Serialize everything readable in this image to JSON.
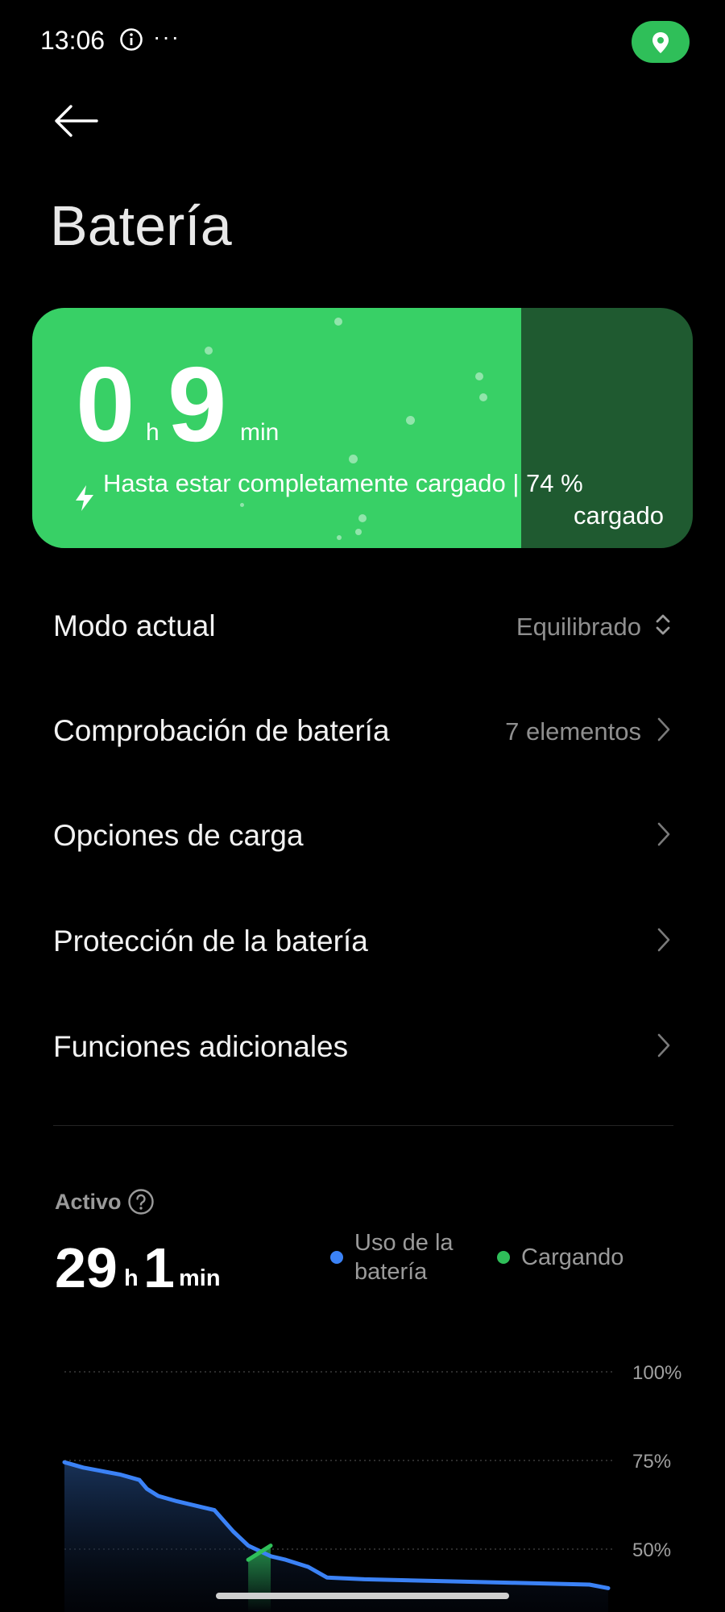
{
  "status_bar": {
    "time": "13:06",
    "dots": "···",
    "icons": [
      "info-icon",
      "location-icon"
    ]
  },
  "header": {
    "title": "Batería"
  },
  "charge_card": {
    "hours": "0",
    "hours_unit": "h",
    "minutes": "9",
    "minutes_unit": "min",
    "message_line1": "Hasta estar completamente cargado | 74 %",
    "message_line2": "cargado",
    "level_percent": 74,
    "colors": {
      "fill": "#38d066",
      "remaining": "#1f5a30"
    }
  },
  "settings": [
    {
      "label": "Modo actual",
      "value": "Equilibrado",
      "icon": "up-down-chevron-icon"
    },
    {
      "label": "Comprobación de batería",
      "value": "7 elementos",
      "icon": "chevron-right-icon"
    },
    {
      "label": "Opciones de carga",
      "value": "",
      "icon": "chevron-right-icon"
    },
    {
      "label": "Protección de la batería",
      "value": "",
      "icon": "chevron-right-icon"
    },
    {
      "label": "Funciones adicionales",
      "value": "",
      "icon": "chevron-right-icon"
    }
  ],
  "active": {
    "label": "Activo",
    "hours": "29",
    "hours_unit": "h",
    "minutes": "1",
    "minutes_unit": "min",
    "legend": [
      {
        "line1": "Uso de la",
        "line2": "batería",
        "color": "#3b82f6"
      },
      {
        "line1": "Cargando",
        "line2": "",
        "color": "#2fbf59"
      }
    ]
  },
  "chart_data": {
    "type": "line",
    "y_ticks": [
      "100%",
      "75%",
      "50%"
    ],
    "ylim": [
      0,
      100
    ],
    "grid": true,
    "series": [
      {
        "name": "Uso de la batería",
        "color": "#3b82f6",
        "x": [
          0,
          0.5,
          1,
          1.5,
          2,
          2.2,
          2.5,
          3,
          4,
          4.5,
          4.9,
          5.5,
          5.9,
          6.5,
          7,
          8,
          10,
          12,
          14,
          14.5
        ],
        "values": [
          74.5,
          73,
          72,
          71,
          69.5,
          67,
          65,
          63.5,
          61,
          55,
          51,
          48,
          47,
          45,
          42,
          41.5,
          41,
          40.5,
          40,
          39
        ]
      },
      {
        "name": "Cargando",
        "color": "#2fbf59",
        "x": [
          4.9,
          5.5
        ],
        "values": [
          47,
          51
        ]
      }
    ]
  }
}
